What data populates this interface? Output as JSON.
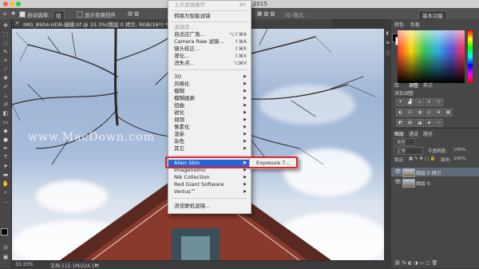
{
  "app": {
    "title_fragment": "CC 2015",
    "workspace": "基本功能"
  },
  "options_bar": {
    "auto_select_label": "自动选择:",
    "auto_select_value": "组",
    "show_transform_label": "显示变换控件",
    "mode_3d": "3D 模式:"
  },
  "document": {
    "tab_title": "IMG_8904-HDR-编辑.tif @ 33.3%(图层 0 拷贝, RGB/16*) *",
    "watermark": "www.MacDown.com",
    "zoom": "33.33%",
    "doc_info": "文档:112.1M/224.1M"
  },
  "filter_menu": {
    "items": [
      {
        "label": "上次滤镜操作",
        "shortcut": "⌘F",
        "disabled": true
      },
      {
        "label": "转换为智能滤镜"
      },
      {
        "label": "滤镜库...",
        "disabled": true
      },
      {
        "label": "自适应广角...",
        "shortcut": "⌥⇧⌘A"
      },
      {
        "label": "Camera Raw 滤镜...",
        "shortcut": "⇧⌘A"
      },
      {
        "label": "镜头校正...",
        "shortcut": "⇧⌘R"
      },
      {
        "label": "液化...",
        "shortcut": "⇧⌘X"
      },
      {
        "label": "消失点...",
        "shortcut": "⌥⌘V"
      },
      {
        "label": "3D"
      },
      {
        "label": "风格化"
      },
      {
        "label": "模糊"
      },
      {
        "label": "模糊画廊"
      },
      {
        "label": "扭曲"
      },
      {
        "label": "锐化"
      },
      {
        "label": "视频"
      },
      {
        "label": "像素化"
      },
      {
        "label": "渲染"
      },
      {
        "label": "杂色"
      },
      {
        "label": "其它"
      },
      {
        "label": "Alien Skin"
      },
      {
        "label": "Imagenomic"
      },
      {
        "label": "Nik Collection"
      },
      {
        "label": "Red Giant Software"
      },
      {
        "label": "Vertus™"
      },
      {
        "label": "浏览联机滤镜..."
      }
    ],
    "submenu_item": "Exposure 7..."
  },
  "panels": {
    "histogram_tab": "直方图",
    "color_tab": "色板",
    "color_panel_tab": "颜色",
    "libraries_tab": "库",
    "adjustments_tab": "调整",
    "styles_tab": "样式",
    "add_adjustment": "添加调整",
    "layers_tab": "图层",
    "channels_tab": "通道",
    "paths_tab": "路径",
    "kind_label": "类型",
    "blend_mode": "正常",
    "opacity_label": "不透明度:",
    "opacity_value": "100%",
    "lock_label": "锁定:",
    "fill_label": "填充:",
    "fill_value": "100%",
    "layers": [
      {
        "name": "图层 0 拷贝",
        "selected": true
      },
      {
        "name": "图层 0",
        "selected": false
      }
    ]
  }
}
